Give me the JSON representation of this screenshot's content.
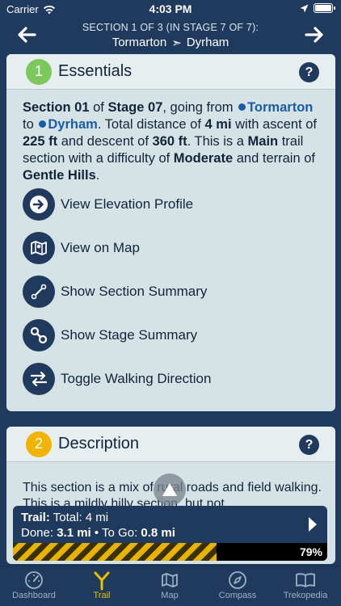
{
  "status": {
    "carrier": "Carrier",
    "time": "4:03 PM"
  },
  "nav": {
    "subtitle": "SECTION 1 OF 3 (IN STAGE 7 OF 7):",
    "from": "Tormarton",
    "separator": "➣",
    "to": "Dyrham"
  },
  "essentials": {
    "number": "1",
    "title": "Essentials",
    "help": "?",
    "text": {
      "section": "Section 01",
      "of": " of ",
      "stage": "Stage 07",
      "going_from": ", going from ",
      "from": "Tormarton",
      "to_word": " to ",
      "to": "Dyrham",
      "total": ". Total distance of ",
      "distance": "4 mi",
      "ascent_pre": " with ascent of ",
      "ascent": "225 ft",
      "descent_pre": " and descent of ",
      "descent": "360 ft",
      "trail_pre": ". This is a ",
      "trail_type": "Main",
      "difficulty_pre": " trail section with a difficulty of ",
      "difficulty": "Moderate",
      "terrain_pre": " and terrain of ",
      "terrain": "Gentle Hills",
      "end": "."
    },
    "actions": [
      {
        "label": "View Elevation Profile",
        "icon": "arrow-right-icon"
      },
      {
        "label": "View on Map",
        "icon": "map-icon"
      },
      {
        "label": "Show Section Summary",
        "icon": "line-segment-icon"
      },
      {
        "label": "Show Stage Summary",
        "icon": "route-icon"
      },
      {
        "label": "Toggle Walking Direction",
        "icon": "swap-icon"
      }
    ]
  },
  "description": {
    "number": "2",
    "title": "Description",
    "help": "?",
    "text": "This section is a mix of rural roads and field walking. This is a mildly hilly section, but not"
  },
  "progress": {
    "line1_label": "Trail:",
    "line1_value": " Total: 4 mi",
    "line2_label": "Done:",
    "line2_value": " 3.1 mi",
    "line2_sep": " • To Go: ",
    "line2_togo": "0.8 mi",
    "percent": 79,
    "percent_label": "79%"
  },
  "tabs": [
    {
      "label": "Dashboard",
      "icon": "gauge-icon",
      "active": false
    },
    {
      "label": "Trail",
      "icon": "trail-fork-icon",
      "active": true
    },
    {
      "label": "Map",
      "icon": "map-icon",
      "active": false
    },
    {
      "label": "Compass",
      "icon": "compass-icon",
      "active": false
    },
    {
      "label": "Trekopedia",
      "icon": "book-icon",
      "active": false
    }
  ],
  "colors": {
    "accent": "#e6c200",
    "navy": "#1f3a5c",
    "green": "#7cc85a",
    "orange": "#f0b400",
    "link": "#1a5ca8"
  }
}
